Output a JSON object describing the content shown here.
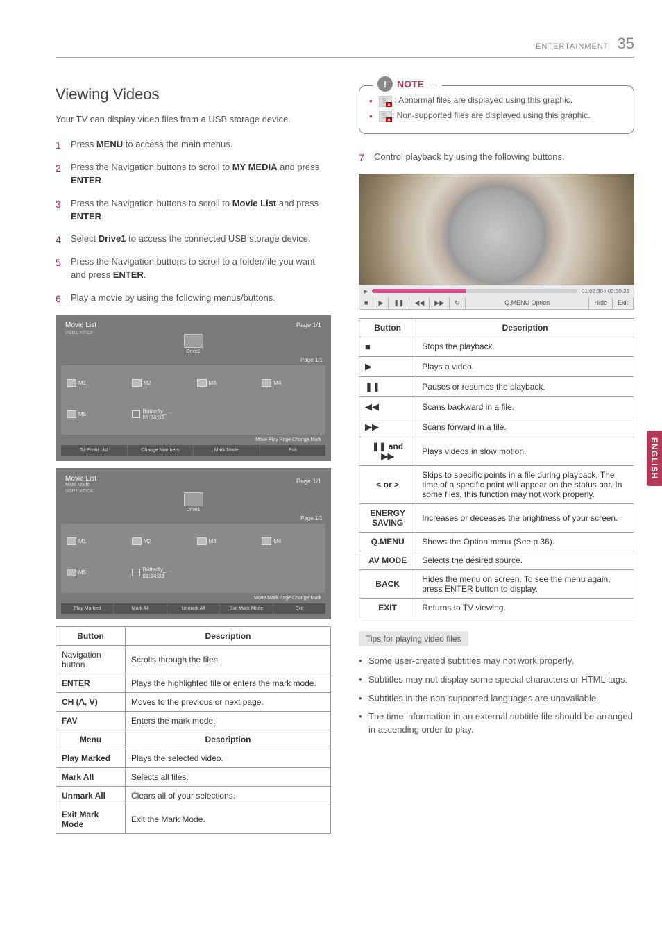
{
  "header": {
    "section": "ENTERTAINMENT",
    "page": "35"
  },
  "side_tab": "ENGLISH",
  "left": {
    "heading": "Viewing Videos",
    "intro": "Your TV can display video files from a USB storage device.",
    "steps": [
      {
        "n": "1",
        "pre": "Press ",
        "bold": "MENU",
        "post": " to access the main menus."
      },
      {
        "n": "2",
        "pre": "Press the Navigation buttons to scroll to ",
        "bold": "MY MEDIA",
        "mid": " and press ",
        "bold2": "ENTER",
        "post": "."
      },
      {
        "n": "3",
        "pre": "Press the Navigation buttons to scroll to ",
        "bold": "Movie List",
        "mid": " and press ",
        "bold2": "ENTER",
        "post": "."
      },
      {
        "n": "4",
        "pre": "Select ",
        "bold": "Drive1",
        "post": " to access the connected USB storage device."
      },
      {
        "n": "5",
        "pre": "Press the Navigation buttons to scroll to a folder/file you want and press ",
        "bold": "ENTER",
        "post": "."
      },
      {
        "n": "6",
        "pre": "Play a movie by using the following menus/buttons.",
        "bold": "",
        "post": ""
      }
    ],
    "panel1": {
      "title": "Movie List",
      "usb": "USB1 XTICK",
      "page_top": "Page 1/1",
      "drive": "Drive1",
      "page_items": "Page 1/1",
      "items": [
        "M1",
        "M2",
        "M3",
        "M4",
        "M5",
        "Butterfly_ ... 01:34:33"
      ],
      "bar_hint": "Move    Play    Page Change    Mark",
      "buttons": [
        "To Photo List",
        "Change Numbers",
        "Mark Mode",
        "Exit"
      ]
    },
    "panel2": {
      "title": "Movie List",
      "sub": "Mark Mode",
      "usb": "USB1 XTICK",
      "page_top": "Page 1/1",
      "drive": "Drive1",
      "page_items": "Page 1/1",
      "items": [
        "M1",
        "M2",
        "M3",
        "M4",
        "M5",
        "Butterfly_ ... 01:34:33"
      ],
      "bar_hint": "Move    Mark    Page Change    Mark",
      "buttons": [
        "Play Marked",
        "Mark All",
        "Unmark All",
        "Exit Mark Mode",
        "Exit"
      ]
    },
    "table1": {
      "h1": "Button",
      "h2": "Description",
      "rows": [
        {
          "b": "Navigation button",
          "d": "Scrolls through the files."
        },
        {
          "b": "ENTER",
          "d": "Plays the highlighted file or enters the mark mode."
        },
        {
          "b": "CH (ꓥ, ꓦ)",
          "d": "Moves to the previous or next page."
        },
        {
          "b": "FAV",
          "d": "Enters the mark mode."
        }
      ],
      "h1b": "Menu",
      "h2b": "Description",
      "rows2": [
        {
          "b": "Play Marked",
          "d": "Plays the selected video."
        },
        {
          "b": "Mark All",
          "d": "Selects all files."
        },
        {
          "b": "Unmark All",
          "d": "Clears all of your selections."
        },
        {
          "b": "Exit Mark Mode",
          "d": "Exit the Mark Mode."
        }
      ]
    }
  },
  "right": {
    "note_label": "NOTE",
    "note_items": [
      {
        "prefix_glyph": "5₁",
        "text": " : Abnormal files are displayed using this graphic."
      },
      {
        "prefix_glyph": "5₁",
        "text": ": Non-supported files are displayed using this graphic."
      }
    ],
    "step7": {
      "n": "7",
      "text": "Control playback by using the following buttons."
    },
    "player": {
      "time": "01:02:30 / 02:30:25",
      "ctrls": [
        "■",
        "▶",
        "❚❚",
        "◀◀",
        "▶▶",
        "↻",
        "Q.MENU Option",
        "Hide",
        "Exit"
      ]
    },
    "table2": {
      "h1": "Button",
      "h2": "Description",
      "rows": [
        {
          "sym": "■",
          "d": "Stops the playback."
        },
        {
          "sym": "▶",
          "d": "Plays a video."
        },
        {
          "sym": "❚❚",
          "d": "Pauses or resumes the playback."
        },
        {
          "sym": "◀◀",
          "d": "Scans backward in a file."
        },
        {
          "sym": "▶▶",
          "d": "Scans forward in a file."
        },
        {
          "sym": "❚❚ and ▶▶",
          "d": "Plays videos in slow motion.",
          "boldlabel": true
        },
        {
          "sym": "< or >",
          "d": "Skips to specific points in a file during playback. The time of a specific point will appear on the status bar. In some files, this function may not work properly.",
          "boldlabel": true
        },
        {
          "sym": "ENERGY SAVING",
          "d": "Increases or deceases the brightness of your screen.",
          "boldlabel": true
        },
        {
          "sym": "Q.MENU",
          "d": "Shows the Option menu (See p.36).",
          "boldlabel": true
        },
        {
          "sym": "AV MODE",
          "d": "Selects the desired source.",
          "boldlabel": true
        },
        {
          "sym": "BACK",
          "d": "Hides the menu on screen. To see the menu again, press ENTER button to display.",
          "boldlabel": true
        },
        {
          "sym": "EXIT",
          "d": "Returns to TV viewing.",
          "boldlabel": true
        }
      ]
    },
    "tips_label": "Tips for playing video files",
    "tips": [
      "Some user-created subtitles may not work properly.",
      "Subtitles may not display some special characters or HTML tags.",
      "Subtitles in the non-supported languages are unavailable.",
      "The time information in an external subtitle file should be arranged in ascending order to play."
    ]
  }
}
